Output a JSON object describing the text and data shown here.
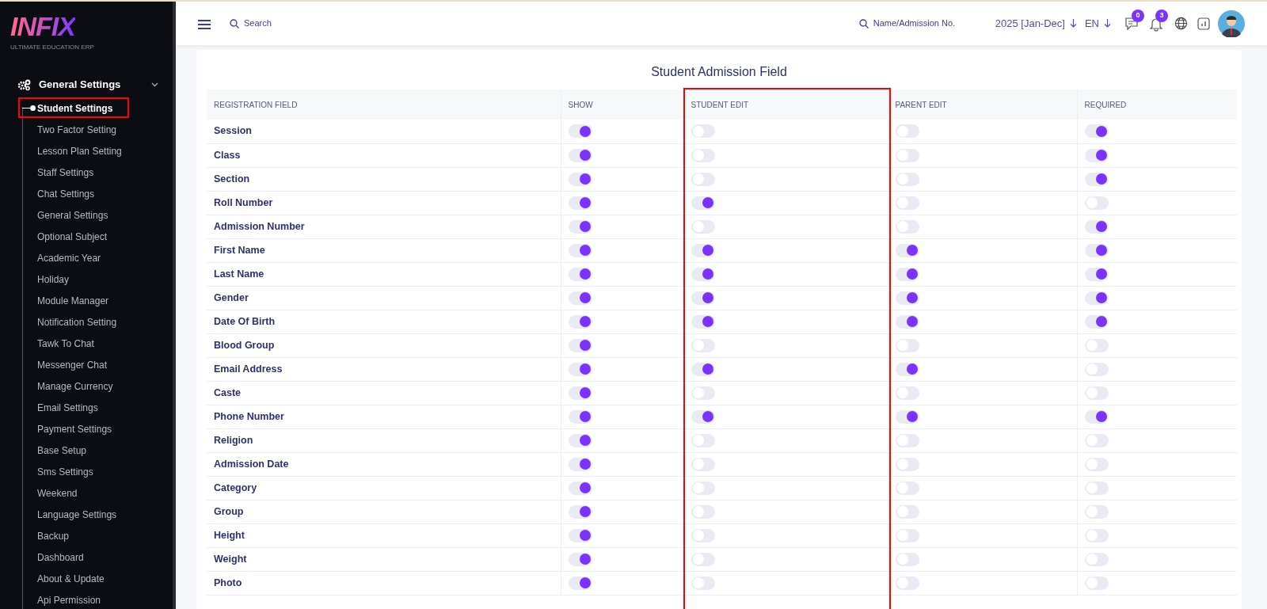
{
  "logo": {
    "name": "INFIX",
    "tagline": "ULTIMATE EDUCATION ERP"
  },
  "sidebar": {
    "group": {
      "label": "General Settings",
      "expanded": true
    },
    "items": [
      {
        "label": "Student Settings",
        "selected": true,
        "highlighted": true
      },
      {
        "label": "Two Factor Setting",
        "selected": false,
        "highlighted": false
      },
      {
        "label": "Lesson Plan Setting",
        "selected": false,
        "highlighted": false
      },
      {
        "label": "Staff Settings",
        "selected": false,
        "highlighted": false
      },
      {
        "label": "Chat Settings",
        "selected": false,
        "highlighted": false
      },
      {
        "label": "General Settings",
        "selected": false,
        "highlighted": false
      },
      {
        "label": "Optional Subject",
        "selected": false,
        "highlighted": false
      },
      {
        "label": "Academic Year",
        "selected": false,
        "highlighted": false
      },
      {
        "label": "Holiday",
        "selected": false,
        "highlighted": false
      },
      {
        "label": "Module Manager",
        "selected": false,
        "highlighted": false
      },
      {
        "label": "Notification Setting",
        "selected": false,
        "highlighted": false
      },
      {
        "label": "Tawk To Chat",
        "selected": false,
        "highlighted": false
      },
      {
        "label": "Messenger Chat",
        "selected": false,
        "highlighted": false
      },
      {
        "label": "Manage Currency",
        "selected": false,
        "highlighted": false
      },
      {
        "label": "Email Settings",
        "selected": false,
        "highlighted": false
      },
      {
        "label": "Payment Settings",
        "selected": false,
        "highlighted": false
      },
      {
        "label": "Base Setup",
        "selected": false,
        "highlighted": false
      },
      {
        "label": "Sms Settings",
        "selected": false,
        "highlighted": false
      },
      {
        "label": "Weekend",
        "selected": false,
        "highlighted": false
      },
      {
        "label": "Language Settings",
        "selected": false,
        "highlighted": false
      },
      {
        "label": "Backup",
        "selected": false,
        "highlighted": false
      },
      {
        "label": "Dashboard",
        "selected": false,
        "highlighted": false
      },
      {
        "label": "About & Update",
        "selected": false,
        "highlighted": false
      },
      {
        "label": "Api Permission",
        "selected": false,
        "highlighted": false
      }
    ]
  },
  "topbar": {
    "search": {
      "placeholder": "Search"
    },
    "student_search": {
      "placeholder": "Name/Admission No."
    },
    "session": "2025 [Jan-Dec]",
    "language": "EN",
    "messages_badge": "0",
    "notifications_badge": "3"
  },
  "page_title": "Student Admission Field",
  "table": {
    "columns": [
      {
        "label": "REGISTRATION FIELD",
        "highlighted": false
      },
      {
        "label": "SHOW",
        "highlighted": false
      },
      {
        "label": "STUDENT EDIT",
        "highlighted": true
      },
      {
        "label": "PARENT EDIT",
        "highlighted": false
      },
      {
        "label": "REQUIRED",
        "highlighted": false
      }
    ],
    "rows": [
      {
        "field": "Session",
        "show": true,
        "student_edit": false,
        "parent_edit": false,
        "required": true
      },
      {
        "field": "Class",
        "show": true,
        "student_edit": false,
        "parent_edit": false,
        "required": true
      },
      {
        "field": "Section",
        "show": true,
        "student_edit": false,
        "parent_edit": false,
        "required": true
      },
      {
        "field": "Roll Number",
        "show": true,
        "student_edit": true,
        "parent_edit": false,
        "required": false
      },
      {
        "field": "Admission Number",
        "show": true,
        "student_edit": false,
        "parent_edit": false,
        "required": true
      },
      {
        "field": "First Name",
        "show": true,
        "student_edit": true,
        "parent_edit": true,
        "required": true
      },
      {
        "field": "Last Name",
        "show": true,
        "student_edit": true,
        "parent_edit": true,
        "required": true
      },
      {
        "field": "Gender",
        "show": true,
        "student_edit": true,
        "parent_edit": true,
        "required": true
      },
      {
        "field": "Date Of Birth",
        "show": true,
        "student_edit": true,
        "parent_edit": true,
        "required": true
      },
      {
        "field": "Blood Group",
        "show": true,
        "student_edit": false,
        "parent_edit": false,
        "required": false
      },
      {
        "field": "Email Address",
        "show": true,
        "student_edit": true,
        "parent_edit": true,
        "required": false
      },
      {
        "field": "Caste",
        "show": true,
        "student_edit": false,
        "parent_edit": false,
        "required": false
      },
      {
        "field": "Phone Number",
        "show": true,
        "student_edit": true,
        "parent_edit": true,
        "required": true
      },
      {
        "field": "Religion",
        "show": true,
        "student_edit": false,
        "parent_edit": false,
        "required": false
      },
      {
        "field": "Admission Date",
        "show": true,
        "student_edit": false,
        "parent_edit": false,
        "required": false
      },
      {
        "field": "Category",
        "show": true,
        "student_edit": false,
        "parent_edit": false,
        "required": false
      },
      {
        "field": "Group",
        "show": true,
        "student_edit": false,
        "parent_edit": false,
        "required": false
      },
      {
        "field": "Height",
        "show": true,
        "student_edit": false,
        "parent_edit": false,
        "required": false
      },
      {
        "field": "Weight",
        "show": true,
        "student_edit": false,
        "parent_edit": false,
        "required": false
      },
      {
        "field": "Photo",
        "show": true,
        "student_edit": false,
        "parent_edit": false,
        "required": false
      }
    ]
  }
}
